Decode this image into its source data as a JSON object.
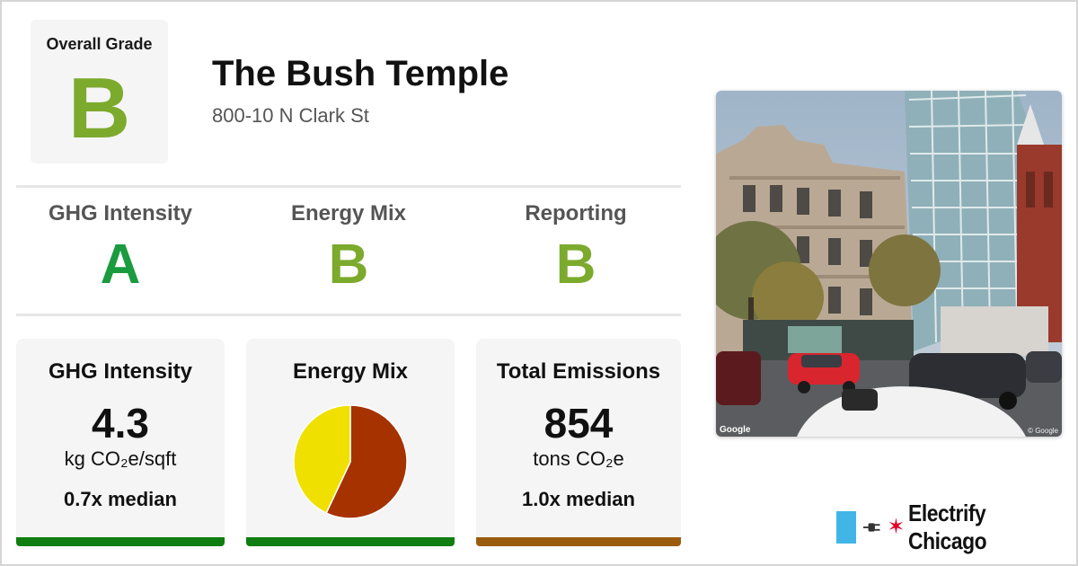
{
  "overall": {
    "label": "Overall Grade",
    "grade": "B",
    "color": "#7caa2d"
  },
  "building": {
    "name": "The Bush Temple",
    "address": "800-10 N Clark St"
  },
  "grades": [
    {
      "label": "GHG Intensity",
      "grade": "A",
      "color": "#1a9b3f"
    },
    {
      "label": "Energy Mix",
      "grade": "B",
      "color": "#7caa2d"
    },
    {
      "label": "Reporting",
      "grade": "B",
      "color": "#7caa2d"
    }
  ],
  "cards": {
    "ghg": {
      "title": "GHG Intensity",
      "value": "4.3",
      "unit": "kg CO₂e/sqft",
      "median": "0.7x median",
      "bar_color": "#0f7d0f"
    },
    "energy": {
      "title": "Energy Mix",
      "bar_color": "#0f7d0f",
      "chart_data": {
        "type": "pie",
        "values": [
          57,
          43
        ],
        "colors": [
          "#a63200",
          "#f0e000"
        ]
      }
    },
    "emissions": {
      "title": "Total Emissions",
      "value": "854",
      "unit": "tons CO₂e",
      "median": "1.0x median",
      "bar_color": "#9a5c0c"
    }
  },
  "photo": {
    "credit": "Google",
    "copyright": "© Google"
  },
  "brand": {
    "name": "Electrify Chicago",
    "accent": "#41b6e6",
    "star": "#e4002b",
    "icons": [
      "chicago-flag-bar-icon",
      "plug-icon",
      "chicago-star-icon"
    ]
  }
}
